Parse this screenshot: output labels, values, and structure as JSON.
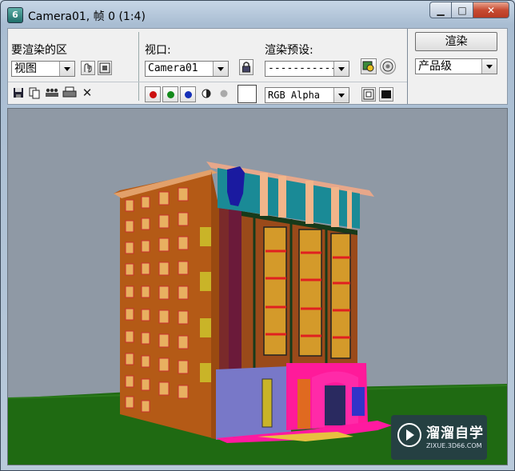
{
  "window": {
    "title": "Camera01, 帧 0 (1:4)",
    "app_icon_glyph": "6",
    "minimize_glyph": "▁",
    "maximize_glyph": "□",
    "close_glyph": "✕"
  },
  "render_setup": {
    "area_label": "要渲染的区",
    "area_value": "视图",
    "viewport_label": "视口:",
    "viewport_value": "Camera01",
    "preset_label": "渲染预设:",
    "preset_value": "------------",
    "render_button": "渲染",
    "quality_value": "产品级"
  },
  "toolbar": {
    "channel_value": "RGB Alpha",
    "close_glyph": "✕",
    "colors": {
      "red": "#cc1111",
      "green": "#138a1b",
      "blue": "#1530b8"
    }
  },
  "icons": [
    "app-icon",
    "region-crop-icon",
    "region-select-icon",
    "lock-icon",
    "render-setup-icon",
    "environment-icon",
    "save-icon",
    "copy-icon",
    "clone-icon",
    "print-icon",
    "clear-icon",
    "red-channel-icon",
    "green-channel-icon",
    "blue-channel-icon",
    "mono-icon",
    "alpha-icon",
    "swatch-icon",
    "display-toggle-icon",
    "color-icon"
  ],
  "watermark": {
    "title": "溜溜自学",
    "subtitle": "ZIXUE.3D66.COM"
  }
}
